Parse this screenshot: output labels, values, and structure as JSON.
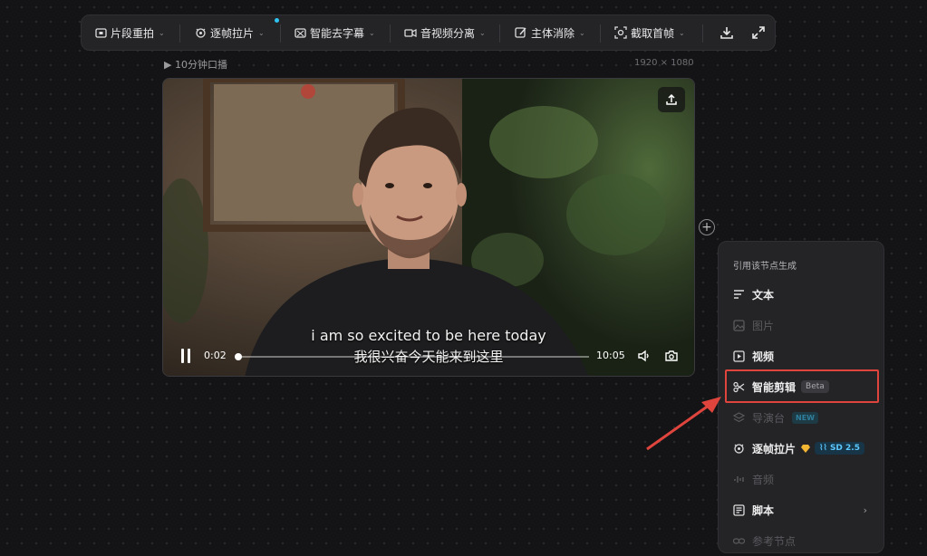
{
  "toolbar": {
    "items": [
      {
        "label": "片段重拍",
        "icon": "clip-redo-icon"
      },
      {
        "label": "逐帧拉片",
        "icon": "frame-by-frame-icon"
      },
      {
        "label": "智能去字幕",
        "icon": "remove-subtitle-icon"
      },
      {
        "label": "音视频分离",
        "icon": "av-separate-icon"
      },
      {
        "label": "主体消除",
        "icon": "subject-erase-icon"
      },
      {
        "label": "截取首帧",
        "icon": "capture-frame-icon"
      }
    ],
    "download_icon": "download-icon",
    "fullscreen_icon": "fullscreen-icon",
    "new_dot_color": "#2ec3f0"
  },
  "node": {
    "title": "▶ 10分钟口播",
    "resolution": "1920 × 1080"
  },
  "video": {
    "subtitle_en": "i am so excited to be here today",
    "subtitle_zh": "我很兴奋今天能来到这里",
    "current_time": "0:02",
    "duration": "10:05",
    "progress": 0.003
  },
  "menu": {
    "heading": "引用该节点生成",
    "items": [
      {
        "label": "文本",
        "icon": "text-icon",
        "enabled": true
      },
      {
        "label": "图片",
        "icon": "image-icon",
        "enabled": false
      },
      {
        "label": "视频",
        "icon": "video-icon",
        "enabled": true
      },
      {
        "label": "智能剪辑",
        "icon": "scissors-icon",
        "enabled": true,
        "badge": "Beta",
        "highlighted": true
      },
      {
        "label": "导演台",
        "icon": "layers-icon",
        "enabled": false,
        "badge": "NEW"
      },
      {
        "label": "逐帧拉片",
        "icon": "frame-by-frame-icon",
        "enabled": true,
        "badge": "SD 2.5"
      },
      {
        "label": "音频",
        "icon": "audio-icon",
        "enabled": false
      },
      {
        "label": "脚本",
        "icon": "script-icon",
        "enabled": true,
        "submenu": true
      },
      {
        "label": "参考节点",
        "icon": "link-icon",
        "enabled": false
      }
    ],
    "highlight_color": "#e0453d"
  }
}
